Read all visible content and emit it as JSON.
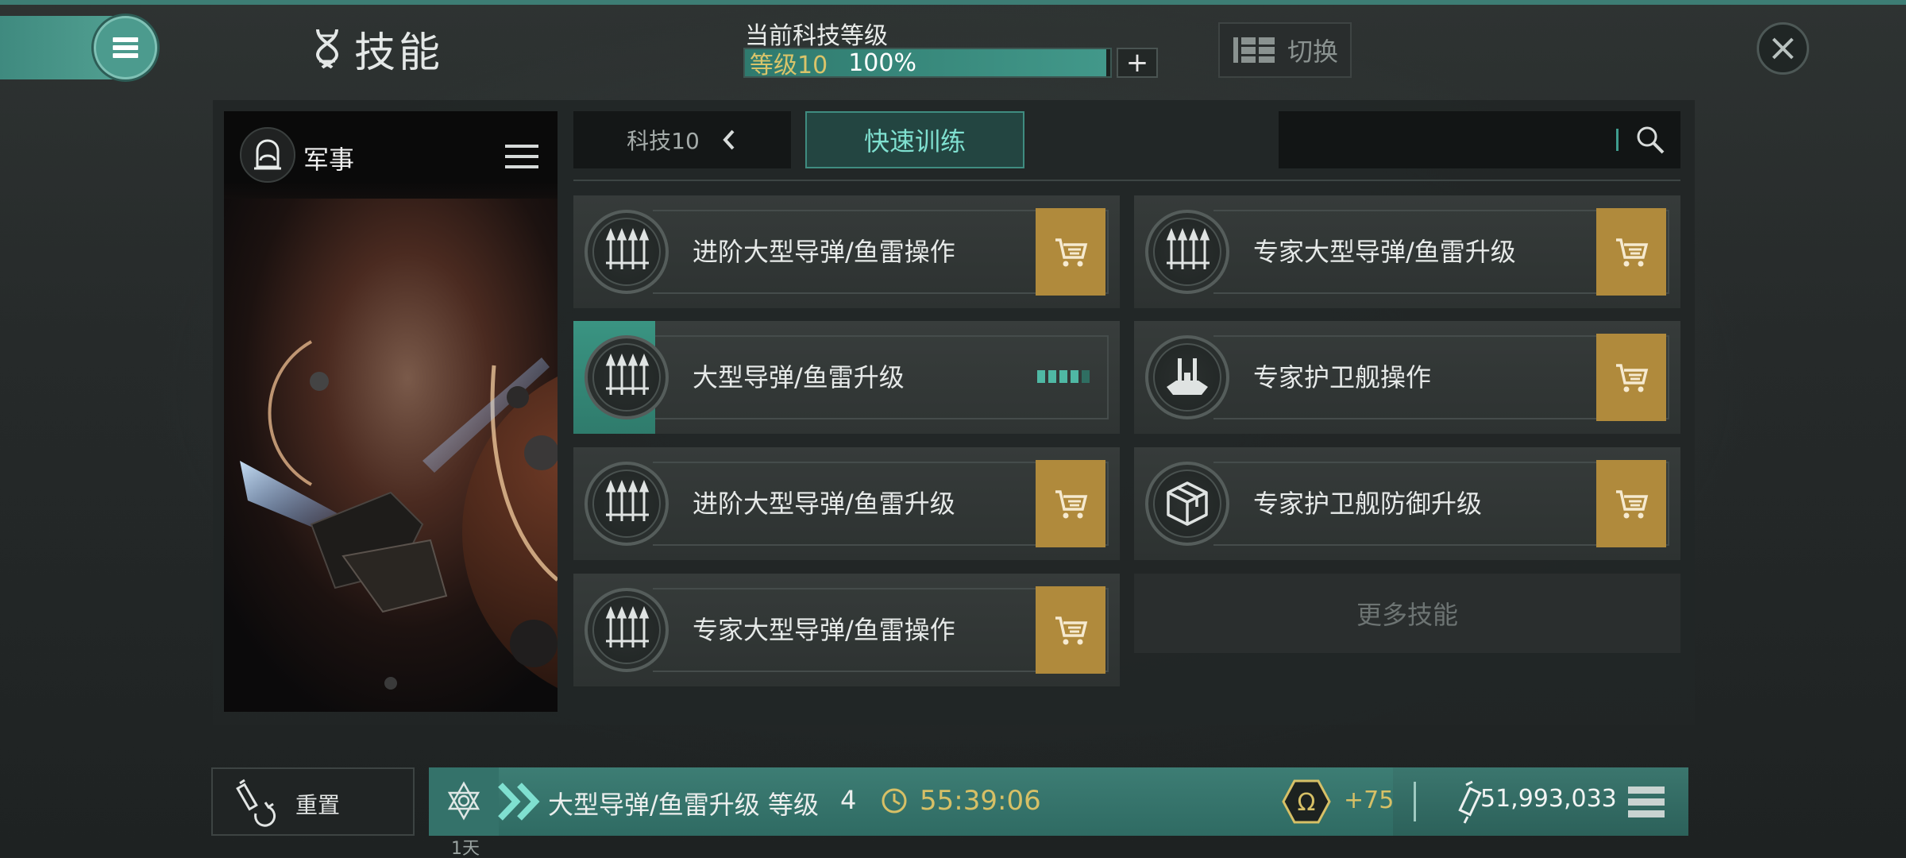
{
  "header": {
    "title": "技能",
    "title_icon": "dna-icon",
    "menu_icon": "hamburger-icon",
    "tech": {
      "label": "当前科技等级",
      "level": "等级10",
      "percent": "100%",
      "progress": 0.99,
      "plus": "+"
    },
    "switch_label": "切换",
    "close_icon": "close-icon"
  },
  "category": {
    "name": "军事",
    "icon": "helmet-icon",
    "menu_icon": "hamburger-icon"
  },
  "toolbar": {
    "tech_filter": "科技10",
    "quick_train": "快速训练",
    "search_placeholder": "",
    "search_icon": "search-icon"
  },
  "skills": [
    {
      "name": "进阶大型导弹/鱼雷操作",
      "icon": "missile-launcher-icon",
      "status": "buy"
    },
    {
      "name": "专家大型导弹/鱼雷升级",
      "icon": "missile-launcher-icon",
      "status": "buy"
    },
    {
      "name": "大型导弹/鱼雷升级",
      "icon": "missile-launcher-icon",
      "status": "training",
      "progress": 0.15,
      "level_pips": 5,
      "level_filled": 4
    },
    {
      "name": "专家护卫舰操作",
      "icon": "frigate-icon",
      "status": "buy"
    },
    {
      "name": "进阶大型导弹/鱼雷升级",
      "icon": "missile-launcher-icon",
      "status": "buy"
    },
    {
      "name": "专家护卫舰防御升级",
      "icon": "armor-cube-icon",
      "status": "buy"
    },
    {
      "name": "专家大型导弹/鱼雷操作",
      "icon": "missile-launcher-icon",
      "status": "buy"
    }
  ],
  "more_skills": "更多技能",
  "bottom": {
    "reset_label": "重置",
    "queue_skill": "大型导弹/鱼雷升级 等级",
    "queue_level": "4",
    "queue_time": "55:39:06",
    "queue_days": "1天",
    "omega_bonus": "+75",
    "skill_points": "51,993,033"
  },
  "colors": {
    "accent_teal": "#3d7d74",
    "cart_gold": "#b08a3c",
    "time_gold": "#d7c066",
    "quick_train_text": "#7fe0d0"
  }
}
